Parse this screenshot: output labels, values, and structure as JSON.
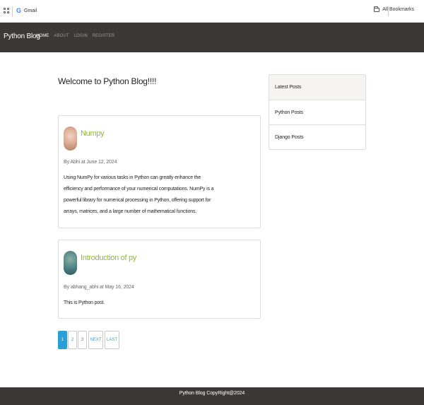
{
  "bookmarks": {
    "gmail_label": "Gmail",
    "all_bookmarks_label": "All Bookmarks"
  },
  "navbar": {
    "brand": "Python Blog",
    "links": [
      "HOME",
      "ABOUT",
      "LOGIN",
      "REGISTER"
    ],
    "active_link": "HOME"
  },
  "main": {
    "welcome": "Welcome to Python Blog!!!!",
    "posts": [
      {
        "title": "Numpy",
        "meta": "By Abhi at June 12, 2024",
        "body": "Using NumPy for various tasks in Python can greatly enhance the efficiency and performance of your numerical computations. NumPy is a powerful library for numerical processing in Python, offering support for arrays, matrices, and a large number of mathematical functions."
      },
      {
        "title": "Introduction of py",
        "meta": "By abhang_abhi at May 16, 2024",
        "body": "This is Python post."
      }
    ],
    "pagination": [
      "1",
      "2",
      "3",
      "NEXT",
      "LAST"
    ],
    "active_page": "1"
  },
  "sidebar": {
    "header": "Latest Posts",
    "items": [
      "Python Posts",
      "Django Posts"
    ]
  },
  "footer": {
    "text": "Python Blog CopyRight@2024"
  },
  "colors": {
    "navbar_bg": "#3a3935",
    "post_title": "#8db83d",
    "accent_blue": "#2a9fd6"
  }
}
